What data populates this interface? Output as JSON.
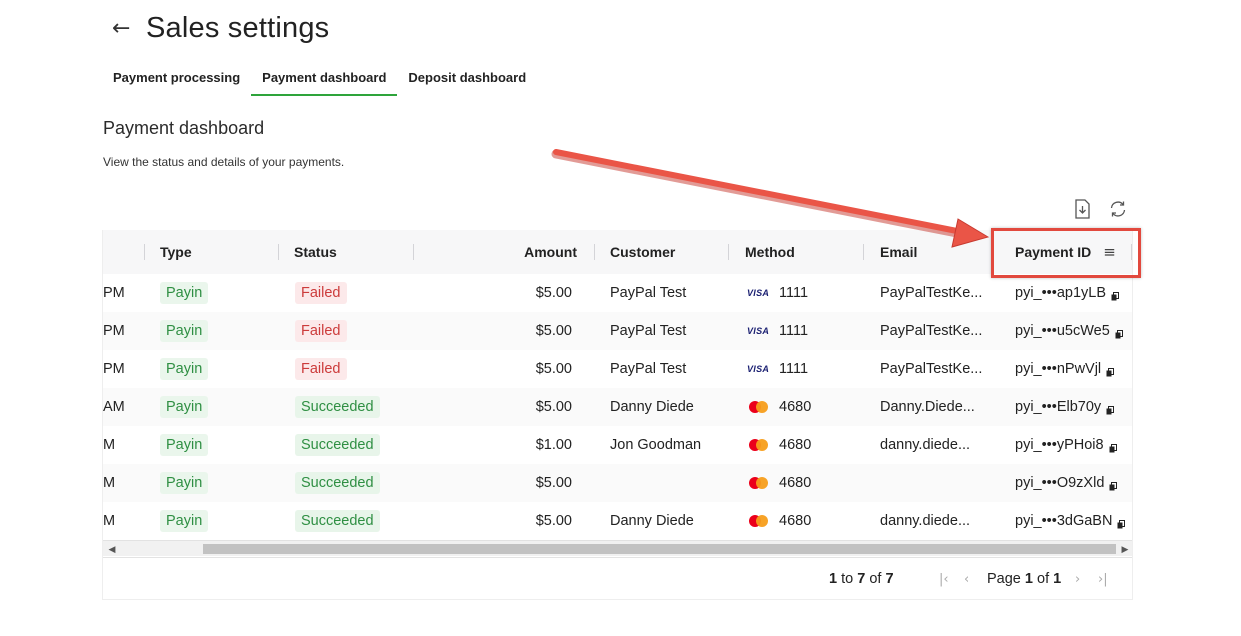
{
  "header": {
    "title": "Sales settings"
  },
  "tabs": [
    {
      "label": "Payment processing",
      "active": false
    },
    {
      "label": "Payment dashboard",
      "active": true
    },
    {
      "label": "Deposit dashboard",
      "active": false
    }
  ],
  "section": {
    "title": "Payment dashboard",
    "description": "View the status and details of your payments."
  },
  "toolbar": {
    "download_icon": "download-icon",
    "refresh_icon": "refresh-icon"
  },
  "columns": {
    "type": "Type",
    "status": "Status",
    "amount": "Amount",
    "customer": "Customer",
    "method": "Method",
    "email": "Email",
    "payment_id": "Payment ID"
  },
  "rows": [
    {
      "time": "PM",
      "type": "Payin",
      "status": "Failed",
      "amount": "$5.00",
      "customer": "PayPal Test",
      "card": "visa",
      "last4": "1111",
      "email": "PayPalTestKe...",
      "payment_id": "pyi_•••ap1yLB"
    },
    {
      "time": "PM",
      "type": "Payin",
      "status": "Failed",
      "amount": "$5.00",
      "customer": "PayPal Test",
      "card": "visa",
      "last4": "1111",
      "email": "PayPalTestKe...",
      "payment_id": "pyi_•••u5cWe5"
    },
    {
      "time": "PM",
      "type": "Payin",
      "status": "Failed",
      "amount": "$5.00",
      "customer": "PayPal Test",
      "card": "visa",
      "last4": "1111",
      "email": "PayPalTestKe...",
      "payment_id": "pyi_•••nPwVjl"
    },
    {
      "time": "AM",
      "type": "Payin",
      "status": "Succeeded",
      "amount": "$5.00",
      "customer": "Danny Diede",
      "card": "mastercard",
      "last4": "4680",
      "email": "Danny.Diede...",
      "payment_id": "pyi_•••Elb70y"
    },
    {
      "time": "M",
      "type": "Payin",
      "status": "Succeeded",
      "amount": "$1.00",
      "customer": "Jon Goodman",
      "card": "mastercard",
      "last4": "4680",
      "email": "danny.diede...",
      "payment_id": "pyi_•••yPHoi8"
    },
    {
      "time": "M",
      "type": "Payin",
      "status": "Succeeded",
      "amount": "$5.00",
      "customer": "",
      "card": "mastercard",
      "last4": "4680",
      "email": "",
      "payment_id": "pyi_•••O9zXld"
    },
    {
      "time": "M",
      "type": "Payin",
      "status": "Succeeded",
      "amount": "$5.00",
      "customer": "Danny Diede",
      "card": "mastercard",
      "last4": "4680",
      "email": "danny.diede...",
      "payment_id": "pyi_•••3dGaBN"
    }
  ],
  "card_labels": {
    "visa": "VISA"
  },
  "pagination": {
    "from": "1",
    "to_word": "to",
    "to": "7",
    "of_word": "of",
    "total": "7",
    "page_word": "Page",
    "page": "1",
    "pages": "1"
  },
  "colors": {
    "accent": "#2ea43b",
    "annotation": "#e2493e"
  }
}
